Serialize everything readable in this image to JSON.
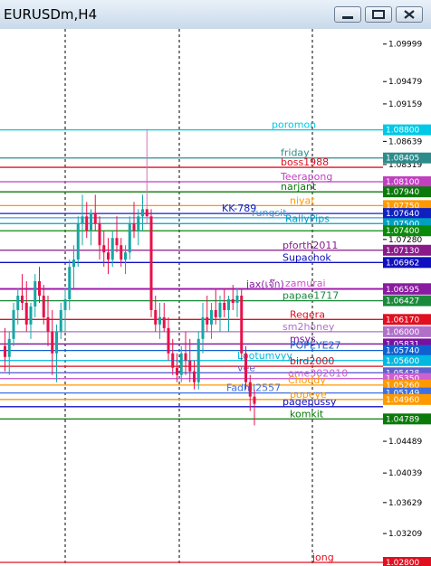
{
  "window": {
    "title": "EURUSDm,H4"
  },
  "axis": {
    "ticks": [
      {
        "y": 1.0999,
        "label": "1.09999"
      },
      {
        "y": 1.0947,
        "label": "1.09479"
      },
      {
        "y": 1.0916,
        "label": "1.09159"
      },
      {
        "y": 1.0864,
        "label": "1.08639"
      },
      {
        "y": 1.0832,
        "label": "1.08319"
      },
      {
        "y": 1.0764,
        "label": "1.07640"
      },
      {
        "y": 1.0728,
        "label": "1.07280"
      },
      {
        "y": 1.0696,
        "label": "1.06960"
      },
      {
        "y": 1.0643,
        "label": "1.06427"
      },
      {
        "y": 1.0617,
        "label": "1.06170"
      },
      {
        "y": 1.0583,
        "label": "1.05831"
      },
      {
        "y": 1.0543,
        "label": "1.05428"
      },
      {
        "y": 1.0515,
        "label": "1.05149"
      },
      {
        "y": 1.0479,
        "label": "1.04789"
      },
      {
        "y": 1.0448,
        "label": "1.04489"
      },
      {
        "y": 1.0404,
        "label": "1.04039"
      },
      {
        "y": 1.0363,
        "label": "1.03629"
      },
      {
        "y": 1.032,
        "label": "1.03209"
      }
    ]
  },
  "levels": [
    {
      "name": "poromon",
      "price": 1.088,
      "tag": "1.08800",
      "color": "#00c8e6"
    },
    {
      "name": "friday",
      "price": 1.0841,
      "tag": "1.08405",
      "color": "#2e8b8b"
    },
    {
      "name": "boss1988",
      "price": 1.0828,
      "tag": "",
      "color": "#e01020"
    },
    {
      "name": "Teerapong",
      "price": 1.0808,
      "tag": "1.08100",
      "color": "#c040c0"
    },
    {
      "name": "narjant",
      "price": 1.0794,
      "tag": "1.07940",
      "color": "#0a7a0a"
    },
    {
      "name": "niyat",
      "price": 1.0775,
      "tag": "1.07750",
      "color": "#ff9900"
    },
    {
      "name": "KK-789",
      "price": 1.0764,
      "tag": "1.07640",
      "color": "#1020c0"
    },
    {
      "name": "rungsit",
      "price": 1.0758,
      "tag": "",
      "color": "#3aa0d8"
    },
    {
      "name": "RallyPips",
      "price": 1.075,
      "tag": "1.07500",
      "color": "#00a0c0"
    },
    {
      "name": "",
      "price": 1.074,
      "tag": "1.07400",
      "color": "#0a8a0a"
    },
    {
      "name": "pforth2011",
      "price": 1.0713,
      "tag": "1.07130",
      "color": "#8a1a8a"
    },
    {
      "name": "Supachok",
      "price": 1.0696,
      "tag": "1.06962",
      "color": "#1010c0"
    },
    {
      "name": "zamurai",
      "price": 1.066,
      "tag": "1.06600",
      "color": "#d050d0"
    },
    {
      "name": "jax(เจ๊ก)",
      "price": 1.0659,
      "tag": "1.06595",
      "color": "#8a1aa0"
    },
    {
      "name": "papae1717",
      "price": 1.0643,
      "tag": "1.06427",
      "color": "#1a8a3a"
    },
    {
      "name": "Regera",
      "price": 1.0617,
      "tag": "1.06170",
      "color": "#e01020"
    },
    {
      "name": "sm2honey",
      "price": 1.06,
      "tag": "1.06000",
      "color": "#b070c8"
    },
    {
      "name": "msys",
      "price": 1.0583,
      "tag": "1.05831",
      "color": "#7a10a0"
    },
    {
      "name": "POPEYE27",
      "price": 1.0574,
      "tag": "1.05740",
      "color": "#1060d0"
    },
    {
      "name": "Lootumvyy",
      "price": 1.056,
      "tag": "1.05600",
      "color": "#00b8e0"
    },
    {
      "name": "bird2000",
      "price": 1.0552,
      "tag": "",
      "color": "#d01020"
    },
    {
      "name": "vee",
      "price": 1.0543,
      "tag": "1.05428",
      "color": "#6060d0"
    },
    {
      "name": "ome302010",
      "price": 1.0535,
      "tag": "1.05350",
      "color": "#d060d0"
    },
    {
      "name": "Choddy",
      "price": 1.0526,
      "tag": "1.05260",
      "color": "#ff9900"
    },
    {
      "name": "Fadhil2557",
      "price": 1.0515,
      "tag": "1.05149",
      "color": "#4070e0"
    },
    {
      "name": "popeye",
      "price": 1.0506,
      "tag": "1.04960",
      "color": "#ff9900"
    },
    {
      "name": "pagepussy",
      "price": 1.0496,
      "tag": "",
      "color": "#1010c0"
    },
    {
      "name": "komkit",
      "price": 1.0479,
      "tag": "1.04789",
      "color": "#0a7a0a"
    },
    {
      "name": "jong",
      "price": 1.028,
      "tag": "1.02800",
      "color": "#e01020"
    }
  ],
  "candles": [
    [
      1.058,
      1.0605,
      1.0545,
      1.0565
    ],
    [
      1.0565,
      1.06,
      1.054,
      1.059
    ],
    [
      1.059,
      1.064,
      1.058,
      1.063
    ],
    [
      1.063,
      1.066,
      1.061,
      1.065
    ],
    [
      1.065,
      1.068,
      1.063,
      1.064
    ],
    [
      1.064,
      1.067,
      1.06,
      1.061
    ],
    [
      1.061,
      1.064,
      1.059,
      1.0635
    ],
    [
      1.0635,
      1.068,
      1.062,
      1.067
    ],
    [
      1.067,
      1.069,
      1.064,
      1.065
    ],
    [
      1.065,
      1.0665,
      1.061,
      1.062
    ],
    [
      1.062,
      1.065,
      1.058,
      1.06
    ],
    [
      1.06,
      1.063,
      1.054,
      1.057
    ],
    [
      1.057,
      1.061,
      1.053,
      1.06
    ],
    [
      1.06,
      1.064,
      1.059,
      1.063
    ],
    [
      1.063,
      1.066,
      1.06,
      1.0645
    ],
    [
      1.0645,
      1.07,
      1.063,
      1.069
    ],
    [
      1.069,
      1.072,
      1.066,
      1.07
    ],
    [
      1.07,
      1.076,
      1.069,
      1.075
    ],
    [
      1.075,
      1.079,
      1.072,
      1.076
    ],
    [
      1.076,
      1.078,
      1.073,
      1.074
    ],
    [
      1.074,
      1.077,
      1.072,
      1.0765
    ],
    [
      1.0765,
      1.079,
      1.074,
      1.075
    ],
    [
      1.075,
      1.076,
      1.07,
      1.072
    ],
    [
      1.072,
      1.074,
      1.069,
      1.071
    ],
    [
      1.071,
      1.073,
      1.068,
      1.07
    ],
    [
      1.07,
      1.074,
      1.069,
      1.073
    ],
    [
      1.073,
      1.076,
      1.071,
      1.072
    ],
    [
      1.072,
      1.073,
      1.069,
      1.07
    ],
    [
      1.07,
      1.072,
      1.068,
      1.071
    ],
    [
      1.071,
      1.076,
      1.07,
      1.075
    ],
    [
      1.075,
      1.078,
      1.073,
      1.074
    ],
    [
      1.074,
      1.077,
      1.072,
      1.076
    ],
    [
      1.076,
      1.079,
      1.074,
      1.077
    ],
    [
      1.077,
      1.088,
      1.075,
      1.076
    ],
    [
      1.076,
      1.077,
      1.062,
      1.063
    ],
    [
      1.063,
      1.065,
      1.06,
      1.061
    ],
    [
      1.061,
      1.064,
      1.059,
      1.062
    ],
    [
      1.062,
      1.064,
      1.06,
      1.0605
    ],
    [
      1.0605,
      1.062,
      1.056,
      1.057
    ],
    [
      1.057,
      1.059,
      1.054,
      1.055
    ],
    [
      1.055,
      1.057,
      1.053,
      1.054
    ],
    [
      1.054,
      1.058,
      1.053,
      1.057
    ],
    [
      1.057,
      1.06,
      1.054,
      1.056
    ],
    [
      1.056,
      1.059,
      1.053,
      1.0545
    ],
    [
      1.0545,
      1.056,
      1.052,
      1.053
    ],
    [
      1.053,
      1.06,
      1.052,
      1.059
    ],
    [
      1.059,
      1.064,
      1.057,
      1.062
    ],
    [
      1.062,
      1.065,
      1.06,
      1.061
    ],
    [
      1.061,
      1.064,
      1.059,
      1.063
    ],
    [
      1.063,
      1.066,
      1.061,
      1.062
    ],
    [
      1.062,
      1.065,
      1.06,
      1.064
    ],
    [
      1.064,
      1.066,
      1.062,
      1.063
    ],
    [
      1.063,
      1.065,
      1.06,
      1.0645
    ],
    [
      1.0645,
      1.0665,
      1.063,
      1.064
    ],
    [
      1.064,
      1.066,
      1.062,
      1.065
    ],
    [
      1.065,
      1.066,
      1.056,
      1.057
    ],
    [
      1.057,
      1.058,
      1.052,
      1.053
    ],
    [
      1.053,
      1.054,
      1.049,
      1.051
    ],
    [
      1.051,
      1.052,
      1.047,
      1.05
    ]
  ],
  "style": {
    "bull": "#17a6a6",
    "bear": "#e8104a",
    "grid": "#000000"
  }
}
